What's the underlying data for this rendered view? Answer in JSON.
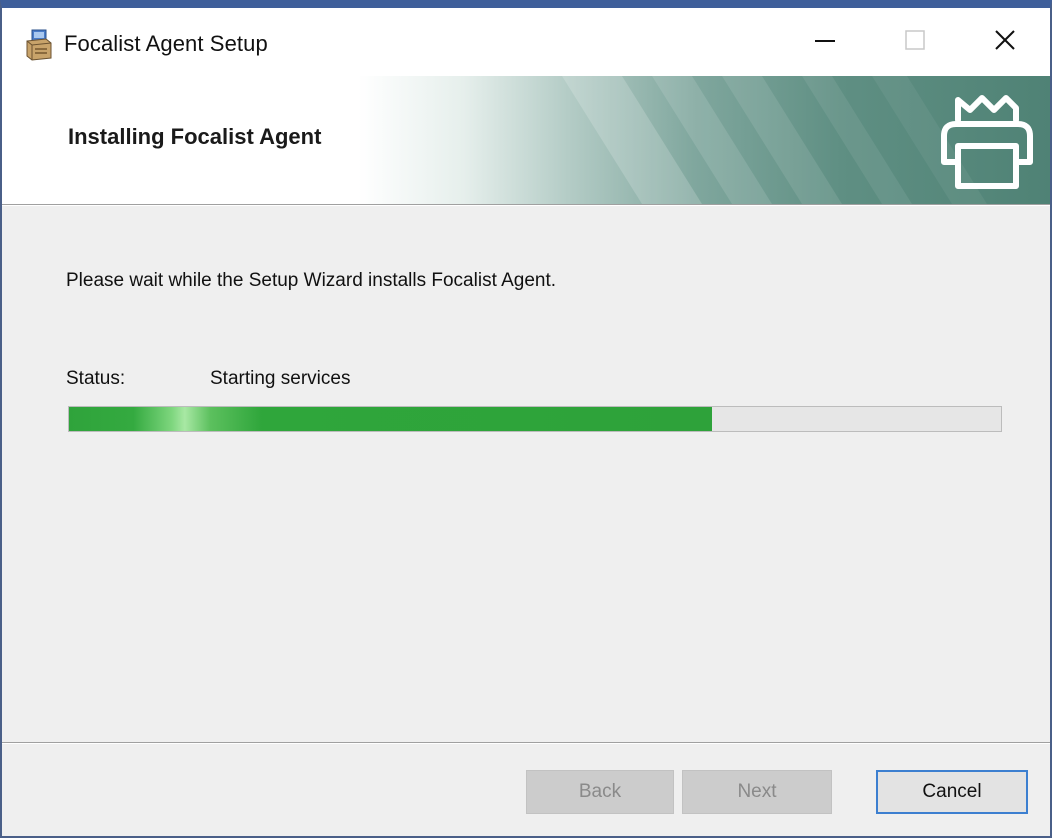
{
  "window": {
    "title": "Focalist Agent Setup",
    "controls": {
      "minimize": "minimize-icon",
      "maximize": "maximize-icon",
      "close": "close-icon"
    }
  },
  "banner": {
    "title": "Installing Focalist Agent",
    "icon": "printer-icon",
    "accent": "#4f8275"
  },
  "body": {
    "message": "Please wait while the Setup Wizard installs Focalist Agent.",
    "status_label": "Status:",
    "status_value": "Starting services",
    "progress_fraction": 0.69,
    "progress_color": "#2ea23a"
  },
  "buttons": {
    "back": "Back",
    "next": "Next",
    "cancel": "Cancel"
  }
}
